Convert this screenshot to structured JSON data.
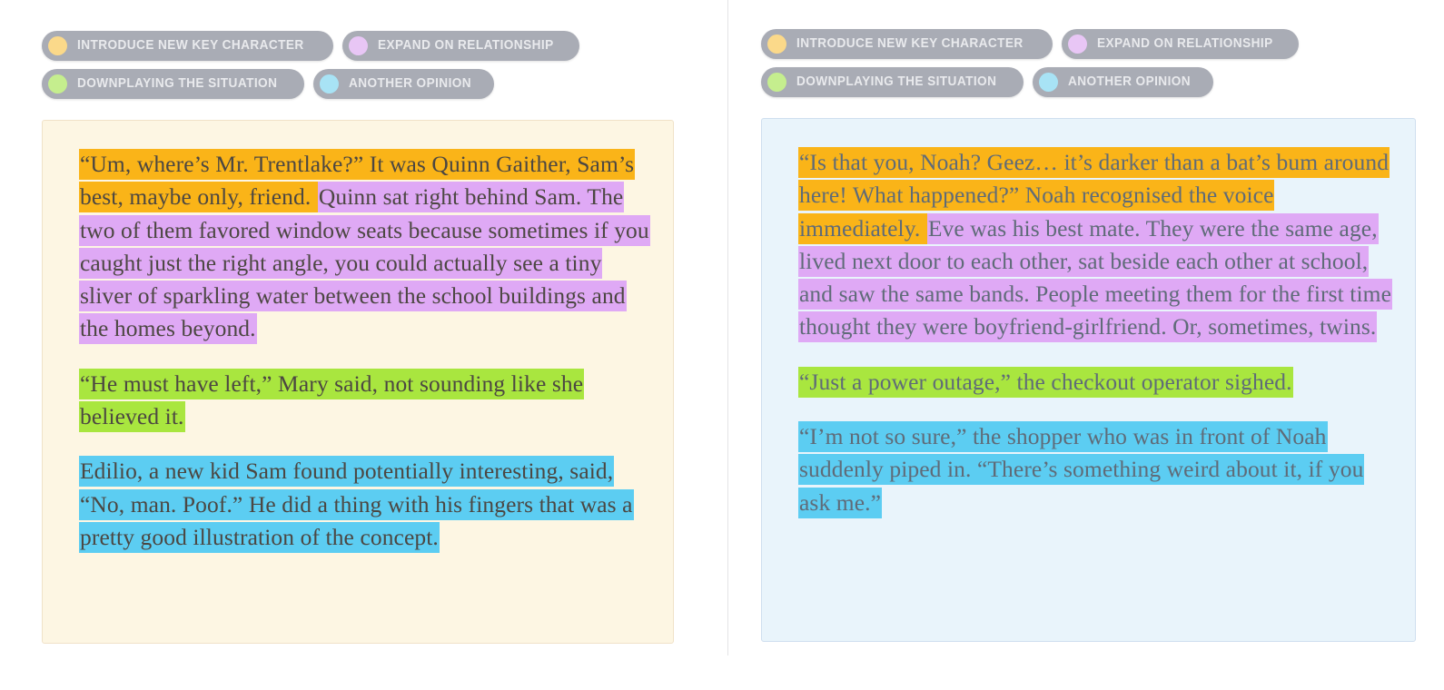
{
  "colors": {
    "chip_bg": "#a9acb5",
    "chip_text": "#e9eaed",
    "dot_orange": "#fbd98a",
    "dot_purple": "#e8c6f5",
    "dot_green": "#c5ee8e",
    "dot_blue": "#a8e3f5",
    "highlight_orange": "#fab418",
    "highlight_purple": "#dfa9f5",
    "highlight_green": "#a9e63f",
    "highlight_blue": "#5ccdf2",
    "card_left_bg": "#fdf6e3",
    "card_left_border": "#f0e2c8",
    "card_right_bg": "#e9f4fb",
    "card_right_border": "#cfdfef",
    "text_left": "#4c4742",
    "text_right": "#5f6b78",
    "divider": "#e3e4e6"
  },
  "legend": [
    {
      "label": "INTRODUCE NEW KEY CHARACTER",
      "dot": "dot_orange"
    },
    {
      "label": "EXPAND ON RELATIONSHIP",
      "dot": "dot_purple"
    },
    {
      "label": "DOWNPLAYING THE SITUATION",
      "dot": "dot_green"
    },
    {
      "label": "ANOTHER OPINION",
      "dot": "dot_blue"
    }
  ],
  "left_panel": {
    "paragraphs": [
      {
        "runs": [
          {
            "text": "“Um, where’s Mr. Trentlake?” It was Quinn Gaither, Sam’s best, maybe only, friend. ",
            "highlight": "orange"
          },
          {
            "text": "Quinn sat right behind Sam. The two of them favored window seats because sometimes if you caught just the right angle, you could actually see a tiny sliver of sparkling water between the school buildings and the homes beyond.",
            "highlight": "purple"
          }
        ]
      },
      {
        "runs": [
          {
            "text": "“He must have left,” Mary said, not sounding like she believed it.",
            "highlight": "green"
          }
        ]
      },
      {
        "runs": [
          {
            "text": "Edilio, a new kid Sam found potentially interesting, said, “No, man. Poof.” He did a thing with his fingers that was a pretty good illustration of the concept.",
            "highlight": "blue"
          }
        ]
      }
    ]
  },
  "right_panel": {
    "paragraphs": [
      {
        "runs": [
          {
            "text": "“Is that you, Noah? Geez… it’s darker than a bat’s bum around here! What happened?” Noah recognised the voice immediately. ",
            "highlight": "orange"
          },
          {
            "text": "Eve was his best mate. They were the same age, lived next door to each other, sat beside each other at school, and saw the same bands. People meeting them for the first time thought they were boyfriend-girlfriend. Or, sometimes, twins.",
            "highlight": "purple"
          }
        ]
      },
      {
        "runs": [
          {
            "text": "“Just a power outage,” the checkout operator sighed.",
            "highlight": "green"
          }
        ]
      },
      {
        "runs": [
          {
            "text": "“I’m not so sure,” the shopper who was in front of Noah suddenly piped in. “There’s something weird about it, if you ask me.”",
            "highlight": "blue"
          }
        ]
      }
    ]
  }
}
